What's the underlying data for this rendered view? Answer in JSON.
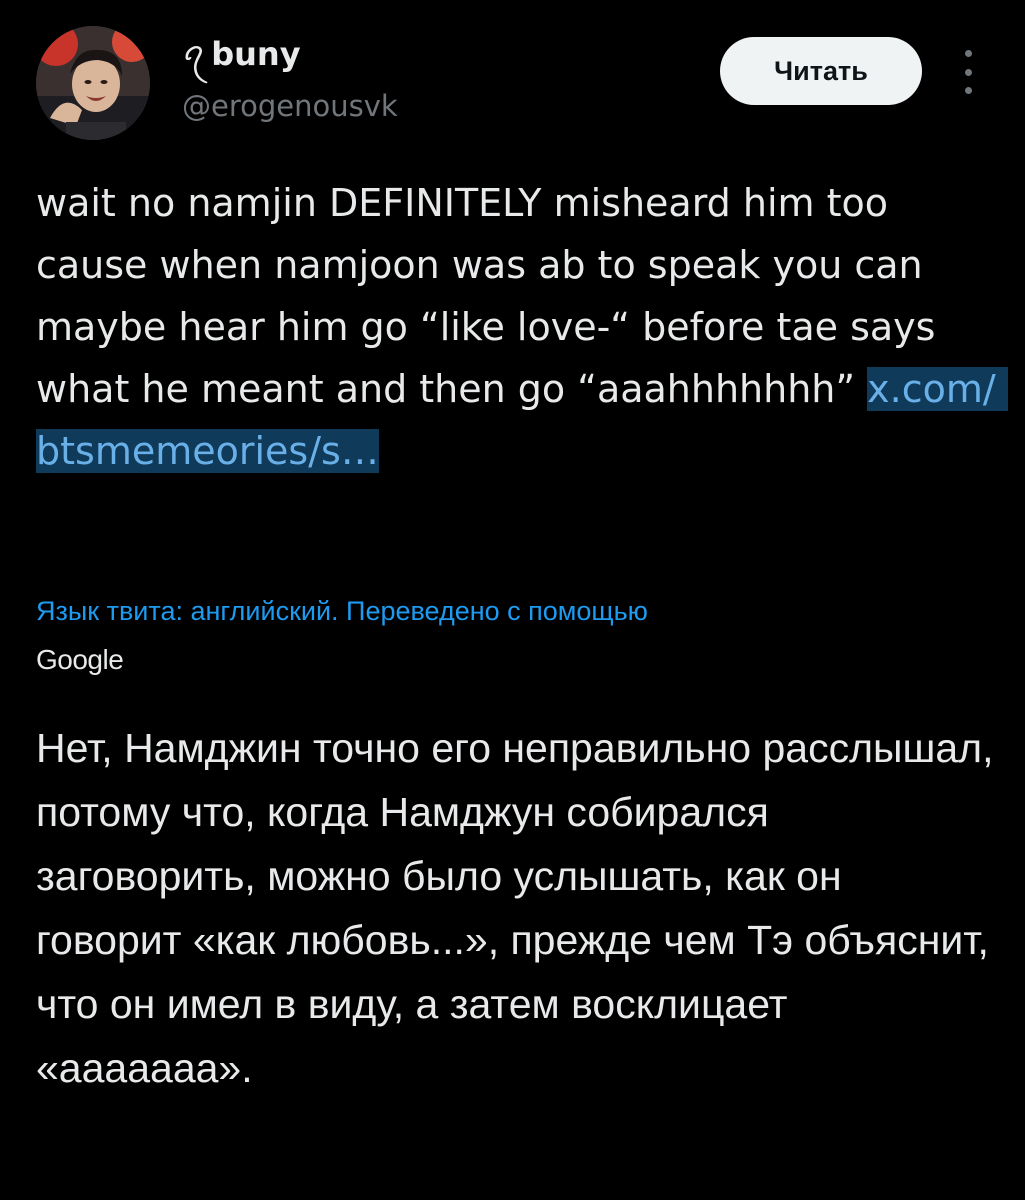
{
  "author": {
    "name_glyph": "ꪖ",
    "display_name": "buny",
    "handle": "@erogenousvk",
    "avatar_icon": "avatar-photo"
  },
  "actions": {
    "follow_label": "Читать",
    "more_icon": "vertical-ellipsis-icon"
  },
  "tweet": {
    "text_plain": "wait no namjin DEFINITELY misheard him too cause when namjoon was ab to speak you can maybe hear him go “like love-“ before tae says what he meant and then go “aaahhhhhhh” ",
    "link_text": "x.com/ btsmemeories/s…",
    "translate_note": "Язык твита: английский. Переведено с помощью",
    "translate_provider": "Google",
    "translation": "Нет, Намджин точно его неправильно расслышал, потому что, когда Намджун собирался заговорить, можно было услышать, как он говорит «как любовь...», прежде чем Тэ объяснит, что он имел в виду, а затем восклицает «ааааааа»."
  },
  "colors": {
    "background": "#000000",
    "text": "#e7e9ea",
    "secondary_text": "#71767b",
    "accent": "#1d9bf0",
    "link_highlight": "#0f3a5a",
    "follow_button_bg": "#eff3f4"
  }
}
